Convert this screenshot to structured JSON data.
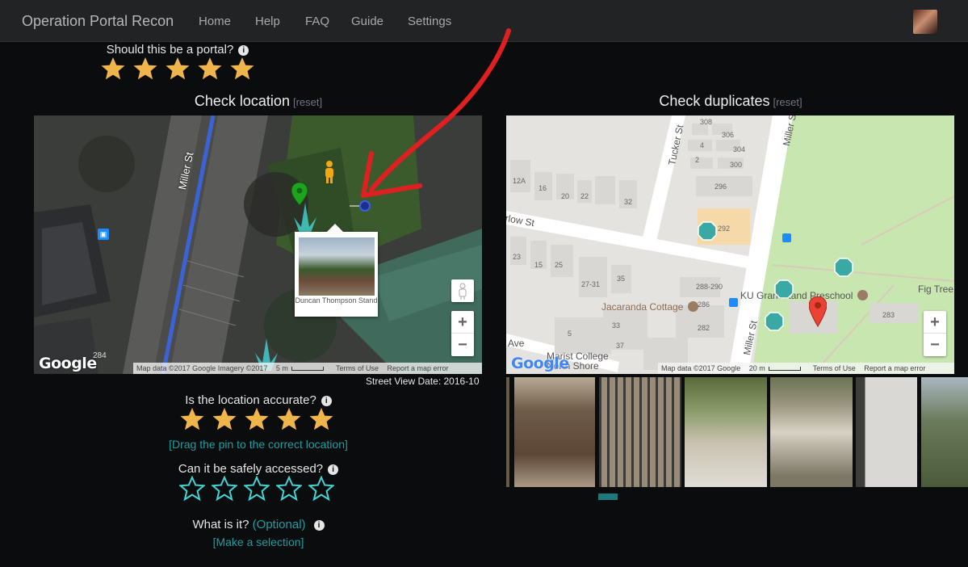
{
  "nav": {
    "brand": "Operation Portal Recon",
    "items": [
      "Home",
      "Help",
      "FAQ",
      "Guide",
      "Settings"
    ]
  },
  "portal_question": {
    "text": "Should this be a portal?",
    "info": "i",
    "rating": 5,
    "max": 5
  },
  "check_location": {
    "title": "Check location",
    "reset": "[reset]",
    "street_label": "Miller St",
    "poi_caption": "Duncan Thompson Stand",
    "map_attr": "Map data ©2017 Google Imagery ©2017",
    "scale": "5 m",
    "terms": "Terms of Use",
    "report": "Report a map error",
    "number": "284",
    "logo": "Google",
    "street_view_date": "Street View Date: 2016-10"
  },
  "check_duplicates": {
    "title": "Check duplicates",
    "reset": "[reset]",
    "map_attr": "Map data ©2017 Google",
    "scale": "20 m",
    "terms": "Terms of Use",
    "report": "Report a map error",
    "logo": "Google",
    "labels": {
      "tucker": "Tucker St",
      "miller": "Miller St",
      "miller2": "Miller St",
      "arlow": "rlow St",
      "fig": "Fig Tree",
      "jacaranda": "Jacaranda Cottage",
      "ku": "KU Grandstand Preschool",
      "marist": "Marist College",
      "north": "North Shore",
      "ave": "Ave"
    },
    "house_numbers": [
      "308",
      "306",
      "4",
      "2",
      "304",
      "300",
      "12A",
      "16",
      "20",
      "22",
      "32",
      "296",
      "292",
      "15",
      "23",
      "25",
      "27-31",
      "35",
      "288-290",
      "286",
      "33",
      "282",
      "5",
      "37",
      "283"
    ]
  },
  "accuracy": {
    "text": "Is the location accurate?",
    "info": "i",
    "rating": 5,
    "max": 5,
    "drag_hint": "[Drag the pin to the correct location]"
  },
  "access": {
    "text": "Can it be safely accessed?",
    "info": "i",
    "rating": 0,
    "max": 5
  },
  "what": {
    "text": "What is it?",
    "optional": "(Optional)",
    "info": "i",
    "selection": "[Make a selection]"
  },
  "colors": {
    "gold": "#f0b54a",
    "teal": "#1d9ea1",
    "cyan": "#43d4d6",
    "arrow": "#e02020"
  }
}
